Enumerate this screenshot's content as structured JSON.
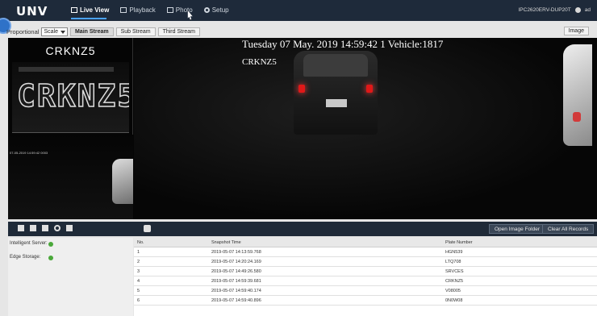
{
  "header": {
    "logo": "UNV",
    "nav": [
      {
        "label": "Live View",
        "active": true
      },
      {
        "label": "Playback",
        "active": false
      },
      {
        "label": "Photo",
        "active": false
      },
      {
        "label": "Setup",
        "active": false
      }
    ],
    "device_name": "IPC2620ERV-DUP20T",
    "user": "ad"
  },
  "toolbar": {
    "scale_label": "Proportional",
    "scale_value": "Scale",
    "streams": [
      {
        "label": "Main Stream",
        "active": true
      },
      {
        "label": "Sub Stream",
        "active": false
      },
      {
        "label": "Third Stream",
        "active": false
      }
    ],
    "image_label": "Image"
  },
  "video": {
    "plate_text": "CRKNZ5",
    "plate_big": "CRKNZ5",
    "left_stamp": "07-05-2019 14:59:42 0003",
    "osd_line": "Tuesday 07 May. 2019 14:59:42 1 Vehicle:1817",
    "osd_plate": "CRKNZ5"
  },
  "midbar": {
    "open_folder_label": "Open Image Folder",
    "clear_records_label": "Clear All Records"
  },
  "status": {
    "intelligent_server": "Intelligent Server:",
    "edge_storage": "Edge Storage:",
    "ok_color": "#4aa83a"
  },
  "table": {
    "headers": {
      "no": "No.",
      "time": "Snapshot Time",
      "plate": "Plate Number"
    },
    "rows": [
      {
        "no": "1",
        "time": "2019-05-07 14:13:59.768",
        "plate": "HGN539"
      },
      {
        "no": "2",
        "time": "2019-05-07 14:20:24.169",
        "plate": "LTQ708"
      },
      {
        "no": "3",
        "time": "2019-05-07 14:49:26.580",
        "plate": "SRVCES"
      },
      {
        "no": "4",
        "time": "2019-05-07 14:59:39.681",
        "plate": "CRKNZ5"
      },
      {
        "no": "5",
        "time": "2019-05-07 14:59:40.174",
        "plate": "V08005"
      },
      {
        "no": "6",
        "time": "2019-05-07 14:59:40.896",
        "plate": "0N0W08"
      }
    ]
  }
}
